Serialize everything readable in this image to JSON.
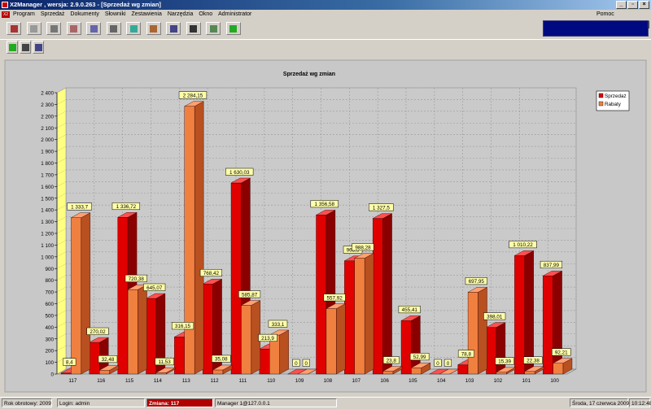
{
  "window": {
    "title": "X2Manager , wersja: 2.9.0.263 - [Sprzedaż wg zmian]"
  },
  "menu": {
    "items": [
      "Program",
      "Sprzedaż",
      "Dokumenty",
      "Słowniki",
      "Zestawienia",
      "Narzędzia",
      "Okno",
      "Administrator"
    ],
    "help": "Pomoc"
  },
  "toolbar": {
    "buttons": [
      "exit-icon",
      "search-icon",
      "edit-icon",
      "settings-icon",
      "document-icon",
      "cash-icon",
      "globe-icon",
      "report-icon",
      "printer-icon",
      "w-icon",
      "copy-icon",
      "money-icon"
    ]
  },
  "toolbar2": {
    "buttons": [
      "money-icon",
      "save-icon",
      "windows-icon"
    ]
  },
  "status": {
    "year": "Rok obrotowy: 2009",
    "login": "Login: admin",
    "shift": "Zmiana: 117",
    "manager": "Manager 1@127.0.0.1",
    "date": "Środa, 17 czerwca 2009",
    "time": "10:12:48"
  },
  "colors": {
    "sprzedaz": "#e00000",
    "rabaty": "#f08040",
    "label_bg": "#ffffaa",
    "left_wall": "#ffff80",
    "status_shift_bg": "#b00000"
  },
  "chart_data": {
    "type": "bar",
    "title": "Sprzedaż wg zmian",
    "xlabel": "",
    "ylabel": "",
    "ylim": [
      0,
      2400
    ],
    "ytick_step": 100,
    "grid": true,
    "legend_position": "top-right",
    "categories": [
      "117",
      "116",
      "115",
      "114",
      "113",
      "112",
      "111",
      "110",
      "109",
      "108",
      "107",
      "106",
      "105",
      "104",
      "103",
      "102",
      "101",
      "100"
    ],
    "series": [
      {
        "name": "Sprzedaż",
        "values": [
          8.4,
          270.02,
          1336.72,
          645.07,
          316.15,
          768.42,
          1630.03,
          213.9,
          0,
          1356.58,
          965.6,
          1327.5,
          455.41,
          0,
          78.8,
          398.01,
          1010.22,
          837.99
        ],
        "labels": [
          "8,4",
          "270,02",
          "1 336,72",
          "645,07",
          "316,15",
          "768,42",
          "1 630,03",
          "213,9",
          "0",
          "1 356,58",
          "965,6",
          "1 327,5",
          "455,41",
          "0",
          "78,8",
          "398,01",
          "1 010,22",
          "837,99"
        ]
      },
      {
        "name": "Rabaty",
        "values": [
          1333.7,
          32.48,
          720.38,
          11.53,
          2284.15,
          35.08,
          585.87,
          333.1,
          0,
          557.92,
          988.28,
          23.8,
          52.99,
          0,
          697.95,
          15.39,
          22.38,
          92.21
        ],
        "labels": [
          "1 333,7",
          "32,48",
          "720,38",
          "11,53",
          "2 284,15",
          "35,08",
          "585,87",
          "333,1",
          "0",
          "557,92",
          "988,28",
          "23,8",
          "52,99",
          "0",
          "697,95",
          "15,39",
          "22,38",
          "92,21"
        ]
      }
    ]
  }
}
